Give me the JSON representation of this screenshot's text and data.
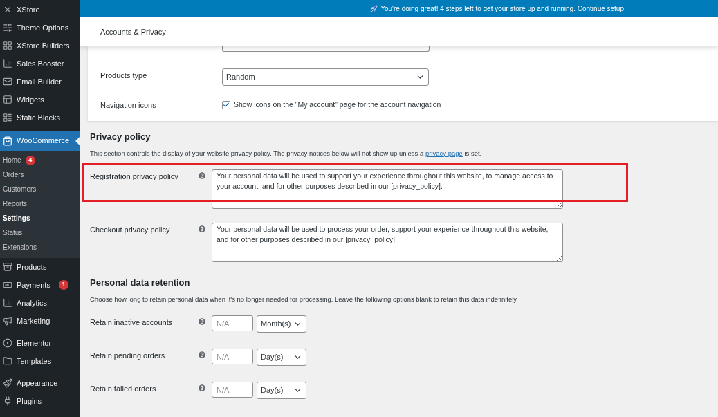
{
  "sidebar": {
    "groups": [
      [
        {
          "label": "XStore",
          "selected": false
        },
        {
          "label": "Theme Options",
          "selected": false
        },
        {
          "label": "XStore Builders",
          "selected": false
        },
        {
          "label": "Sales Booster",
          "selected": false
        },
        {
          "label": "Email Builder",
          "selected": false
        },
        {
          "label": "Widgets",
          "selected": false
        },
        {
          "label": "Static Blocks",
          "selected": false
        }
      ],
      [
        {
          "label": "WooCommerce",
          "selected": true,
          "children": [
            {
              "label": "Home",
              "badge": "4",
              "selected": false
            },
            {
              "label": "Orders",
              "selected": false
            },
            {
              "label": "Customers",
              "selected": false
            },
            {
              "label": "Reports",
              "selected": false
            },
            {
              "label": "Settings",
              "selected": true
            },
            {
              "label": "Status",
              "selected": false
            },
            {
              "label": "Extensions",
              "selected": false
            }
          ]
        },
        {
          "label": "Products",
          "selected": false
        },
        {
          "label": "Payments",
          "badge": "1",
          "selected": false
        },
        {
          "label": "Analytics",
          "selected": false
        },
        {
          "label": "Marketing",
          "selected": false
        }
      ],
      [
        {
          "label": "Elementor",
          "selected": false
        },
        {
          "label": "Templates",
          "selected": false
        }
      ],
      [
        {
          "label": "Appearance",
          "selected": false
        },
        {
          "label": "Plugins",
          "selected": false
        }
      ]
    ]
  },
  "banner": {
    "message": "You're doing great! 4 steps left to get your store up and running.",
    "link": "Continue setup"
  },
  "header": {
    "title": "Accounts & Privacy"
  },
  "card": {
    "rows": [
      {
        "kind": "select",
        "label": "Products type",
        "value": "Random"
      },
      {
        "kind": "checkbox",
        "label": "Navigation icons",
        "text": "Show icons on the \"My account\" page for the account navigation",
        "checked": true
      }
    ]
  },
  "sections": [
    {
      "title": "Privacy policy",
      "description_before": "This section controls the display of your website privacy policy. The privacy notices below will not show up unless a",
      "description_link": "privacy page",
      "description_after": "is set.",
      "rows": [
        {
          "kind": "textarea",
          "label": "Registration privacy policy",
          "value": "Your personal data will be used to support your experience throughout this website, to manage access to your account, and for other purposes described in our [privacy_policy].",
          "highlighted": true
        },
        {
          "kind": "textarea",
          "label": "Checkout privacy policy",
          "value": "Your personal data will be used to process your order, support your experience throughout this website, and for other purposes described in our [privacy_policy].",
          "highlighted": false
        }
      ]
    },
    {
      "title": "Personal data retention",
      "description_before": "Choose how long to retain personal data when it's no longer needed for processing. Leave the following options blank to retain this data indefinitely.",
      "rows": [
        {
          "kind": "period",
          "label": "Retain inactive accounts",
          "placeholder": "N/A",
          "unit": "Month(s)"
        },
        {
          "kind": "period",
          "label": "Retain pending orders",
          "placeholder": "N/A",
          "unit": "Day(s)"
        },
        {
          "kind": "period",
          "label": "Retain failed orders",
          "placeholder": "N/A",
          "unit": "Day(s)"
        }
      ]
    }
  ]
}
